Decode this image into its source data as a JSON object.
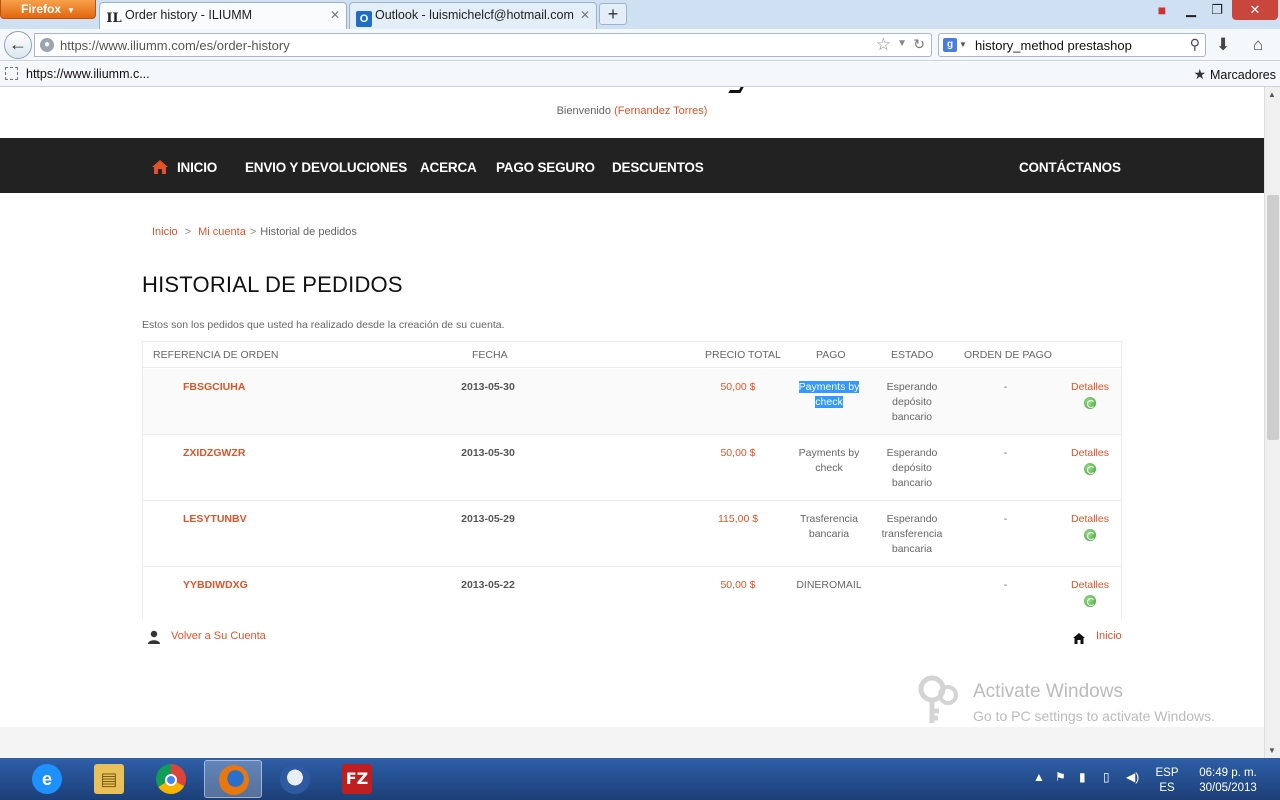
{
  "browser": {
    "app_button": "Firefox",
    "tabs": [
      {
        "icon": "IL",
        "title": "Order history - ILIUMM"
      },
      {
        "icon": "O",
        "title": "Outlook - luismichelcf@hotmail.com"
      }
    ],
    "url": "https://www.iliumm.com/es/order-history",
    "search_value": "history_method prestashop",
    "bookmark_link": "https://www.iliumm.c...",
    "bookmarks_menu": "Marcadores"
  },
  "header": {
    "welcome_prefix": "Bienvenido",
    "welcome_user": "(Fernandez Torres)"
  },
  "menu": {
    "items": [
      "INICIO",
      "ENVIO Y DEVOLUCIONES",
      "ACERCA",
      "PAGO SEGURO",
      "DESCUENTOS"
    ],
    "contact": "CONTÁCTANOS"
  },
  "breadcrumb": {
    "home": "Inicio",
    "sep": ">",
    "account": "Mi cuenta",
    "current": "Historial de pedidos"
  },
  "page": {
    "title": "HISTORIAL DE PEDIDOS",
    "description": "Estos son los pedidos que usted ha realizado desde la creación de su cuenta."
  },
  "table": {
    "headers": [
      "REFERENCIA DE ORDEN",
      "FECHA",
      "PRECIO TOTAL",
      "PAGO",
      "ESTADO",
      "ORDEN DE PAGO"
    ],
    "rows": [
      {
        "ref": "FBSGCIUHA",
        "date": "2013-05-30",
        "price": "50,00 $",
        "pay_line1": "Payments by",
        "pay_line2": "check",
        "state_line1": "Esperando",
        "state_line2": "depósito",
        "state_line3": "bancario",
        "order_pay": "-",
        "details": "Detalles"
      },
      {
        "ref": "ZXIDZGWZR",
        "date": "2013-05-30",
        "price": "50,00 $",
        "pay_line1": "Payments by",
        "pay_line2": "check",
        "state_line1": "Esperando",
        "state_line2": "depósito",
        "state_line3": "bancario",
        "order_pay": "-",
        "details": "Detalles"
      },
      {
        "ref": "LESYTUNBV",
        "date": "2013-05-29",
        "price": "115,00 $",
        "pay_line1": "Trasferencia",
        "pay_line2": "bancaria",
        "state_line1": "Esperando",
        "state_line2": "transferencia",
        "state_line3": "bancaria",
        "order_pay": "-",
        "details": "Detalles"
      },
      {
        "ref": "YYBDIWDXG",
        "date": "2013-05-22",
        "price": "50,00 $",
        "pay_line1": "DINEROMAIL",
        "pay_line2": "",
        "state_line1": "",
        "state_line2": "",
        "state_line3": "",
        "order_pay": "-",
        "details": "Detalles"
      }
    ]
  },
  "footer": {
    "back_account": "Volver a Su Cuenta",
    "home": "Inicio"
  },
  "watermark": {
    "line1": "Activate Windows",
    "line2": "Go to PC settings to activate Windows."
  },
  "taskbar": {
    "lang_top": "ESP",
    "lang_bottom": "ES",
    "time": "06:49 p. m.",
    "date": "30/05/2013"
  },
  "colors": {
    "accent": "#e25328",
    "menu_bg": "#222222",
    "selection": "#3399ff"
  }
}
